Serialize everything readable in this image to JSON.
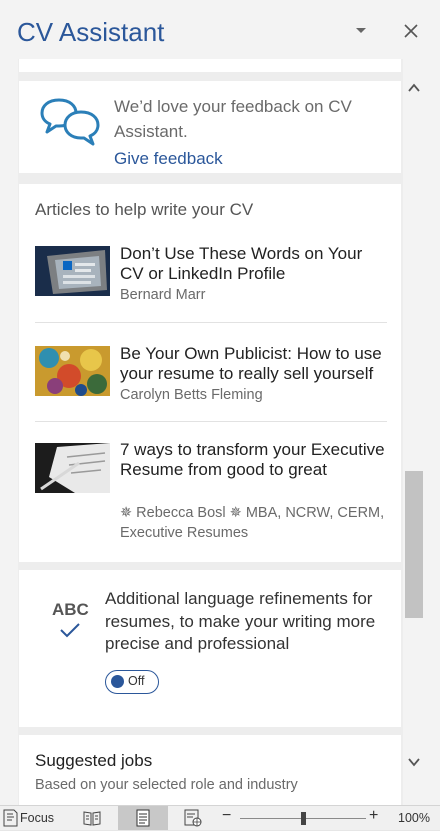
{
  "pane": {
    "title": "CV Assistant"
  },
  "feedback": {
    "text": "We’d love your feedback on CV Assistant.",
    "link": "Give feedback"
  },
  "articles": {
    "heading": "Articles to help write your CV",
    "items": [
      {
        "title": "Don’t Use These Words on Your CV or LinkedIn Profile",
        "author": "Bernard Marr"
      },
      {
        "title": "Be Your Own Publicist: How to use your resume to really sell yourself",
        "author": "Carolyn Betts Fleming"
      },
      {
        "title": "7 ways to transform your Executive Resume from good to great",
        "author": "✵ Rebecca Bosl ✵ MBA, NCRW, CERM, Executive Resumes"
      }
    ]
  },
  "refinements": {
    "icon_text": "ABC",
    "text": "Additional language refinements for resumes, to make your writing more precise and professional",
    "toggle_label": "Off",
    "toggle_on": false
  },
  "jobs": {
    "heading": "Suggested jobs",
    "subtext": "Based on your selected role and industry"
  },
  "statusbar": {
    "focus_label": "Focus",
    "zoom_minus": "−",
    "zoom_plus": "+",
    "zoom_percent": "100%"
  },
  "colors": {
    "accent": "#2b579a",
    "pane_background": "#f3f3f3",
    "card_background": "#ffffff"
  }
}
